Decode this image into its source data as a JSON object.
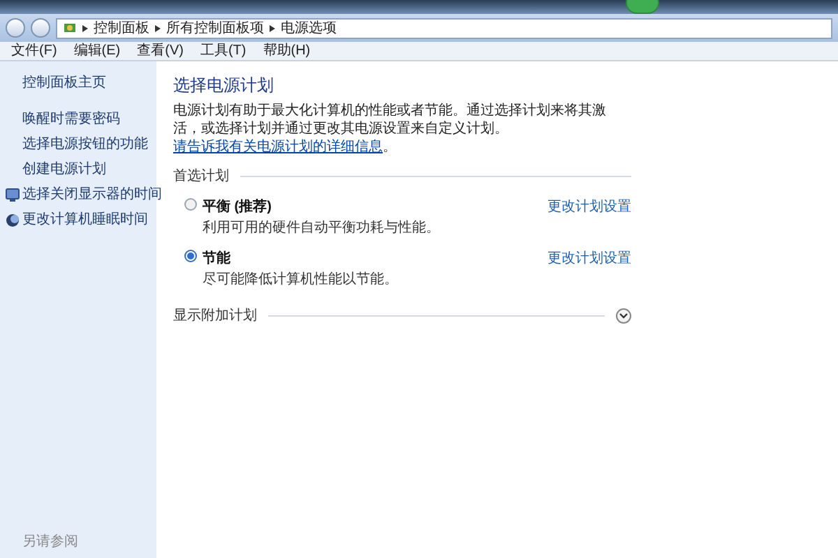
{
  "address_bar": {
    "crumbs": [
      "控制面板",
      "所有控制面板项",
      "电源选项"
    ]
  },
  "menu": [
    "文件(F)",
    "编辑(E)",
    "查看(V)",
    "工具(T)",
    "帮助(H)"
  ],
  "sidebar": {
    "items": [
      {
        "label": "控制面板主页",
        "kind": "home"
      },
      {
        "label": "唤醒时需要密码",
        "kind": "link"
      },
      {
        "label": "选择电源按钮的功能",
        "kind": "link"
      },
      {
        "label": "创建电源计划",
        "kind": "link"
      },
      {
        "label": "选择关闭显示器的时间",
        "kind": "monitor"
      },
      {
        "label": "更改计算机睡眠时间",
        "kind": "moon"
      }
    ],
    "see_also": "另请参阅"
  },
  "content": {
    "title": "选择电源计划",
    "intro": "电源计划有助于最大化计算机的性能或者节能。通过选择计划来将其激活，或选择计划并通过更改其电源设置来自定义计划。",
    "intro_link": "请告诉我有关电源计划的详细信息",
    "intro_end": "。",
    "group": "首选计划",
    "plans": [
      {
        "name": "平衡 (推荐)",
        "description": "利用可用的硬件自动平衡功耗与性能。",
        "link": "更改计划设置",
        "selected": false
      },
      {
        "name": "节能",
        "description": "尽可能降低计算机性能以节能。",
        "link": "更改计划设置",
        "selected": true
      }
    ],
    "more": {
      "label": "显示附加计划",
      "expanded": false
    }
  }
}
